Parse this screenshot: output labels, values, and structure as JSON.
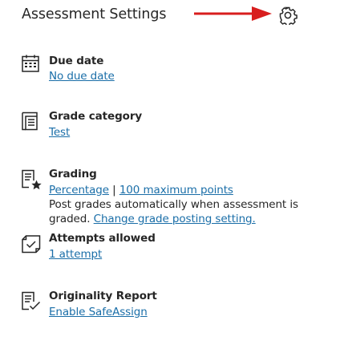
{
  "header": {
    "title": "Assessment Settings",
    "arrow_color": "#d81e1e",
    "gear_icon": "gear-icon"
  },
  "due_date": {
    "label": "Due date",
    "value": "No due date",
    "icon": "calendar-icon"
  },
  "grade_category": {
    "label": "Grade category",
    "value": "Test",
    "icon": "grade-category-icon"
  },
  "grading": {
    "label": "Grading",
    "type_link": "Percentage",
    "separator": "|",
    "points_link": "100 maximum points",
    "posting_text_1": "Post grades automatically when assessment is",
    "posting_text_2": "graded.",
    "posting_link": "Change grade posting setting.",
    "icon": "grading-icon"
  },
  "attempts": {
    "label": "Attempts allowed",
    "value": "1 attempt",
    "icon": "attempts-icon"
  },
  "originality": {
    "label": "Originality Report",
    "value": "Enable SafeAssign",
    "icon": "originality-report-icon"
  },
  "colors": {
    "link": "#1a6ea8",
    "text": "#262626",
    "icon": "#262626"
  }
}
